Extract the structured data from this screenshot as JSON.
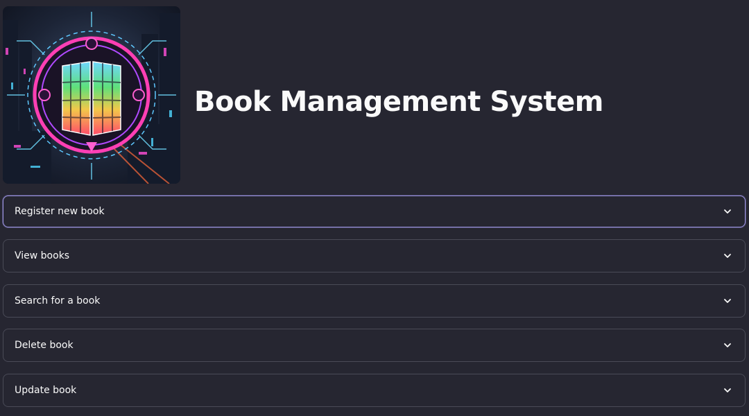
{
  "header": {
    "title": "Book Management System",
    "logo_icon": "neon-book-city-logo"
  },
  "expanders": [
    {
      "label": "Register new book",
      "focused": true
    },
    {
      "label": "View books",
      "focused": false
    },
    {
      "label": "Search for a book",
      "focused": false
    },
    {
      "label": "Delete book",
      "focused": false
    },
    {
      "label": "Update book",
      "focused": false
    }
  ],
  "colors": {
    "background": "#262631",
    "border": "#4a4b57",
    "focus_border": "#9b93e0",
    "text": "#fafafa"
  }
}
